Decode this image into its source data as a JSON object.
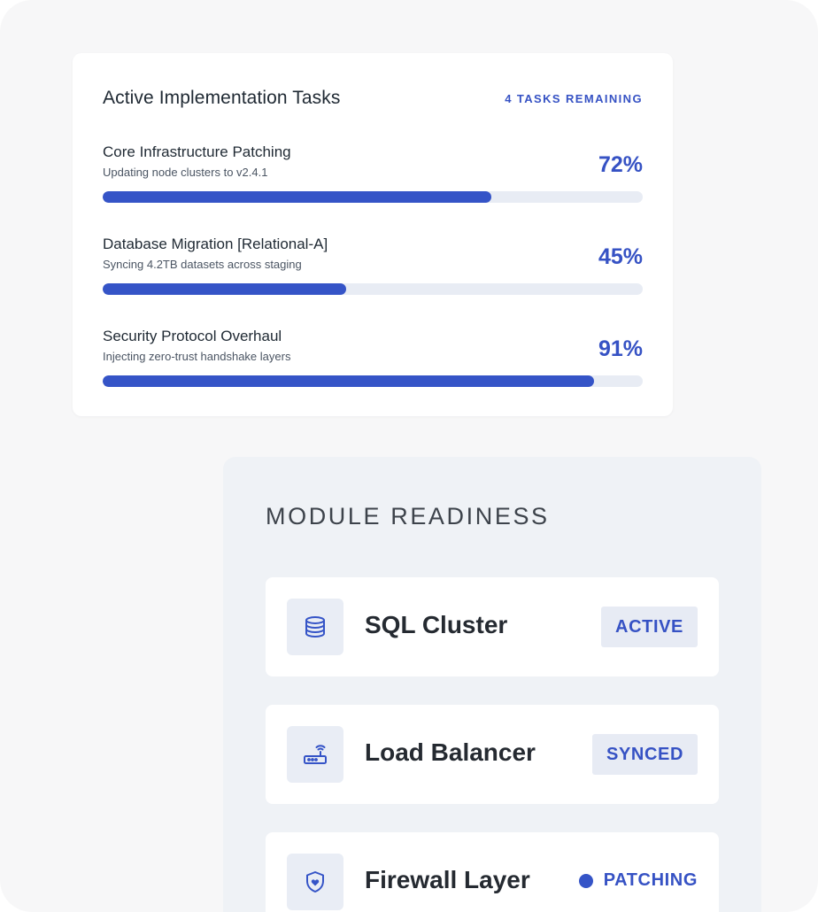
{
  "tasks": {
    "title": "Active Implementation Tasks",
    "remaining": "4 TASKS REMAINING",
    "items": [
      {
        "name": "Core Infrastructure Patching",
        "desc": "Updating node clusters to v2.4.1",
        "percent_label": "72%",
        "progress": 72
      },
      {
        "name": "Database Migration [Relational-A]",
        "desc": "Syncing 4.2TB datasets across staging",
        "percent_label": "45%",
        "progress": 45
      },
      {
        "name": "Security Protocol Overhaul",
        "desc": "Injecting zero-trust handshake layers",
        "percent_label": "91%",
        "progress": 91
      }
    ]
  },
  "modules": {
    "title": "MODULE READINESS",
    "items": [
      {
        "name": "SQL Cluster",
        "status": "ACTIVE",
        "icon": "database-icon"
      },
      {
        "name": "Load Balancer",
        "status": "SYNCED",
        "icon": "router-icon"
      },
      {
        "name": "Firewall Layer",
        "status": "PATCHING",
        "icon": "shield-icon"
      }
    ]
  },
  "colors": {
    "accent": "#3554c7",
    "track": "#e8ecf4",
    "page_bg": "#f7f7f8",
    "panel_bg": "#eff2f6"
  }
}
